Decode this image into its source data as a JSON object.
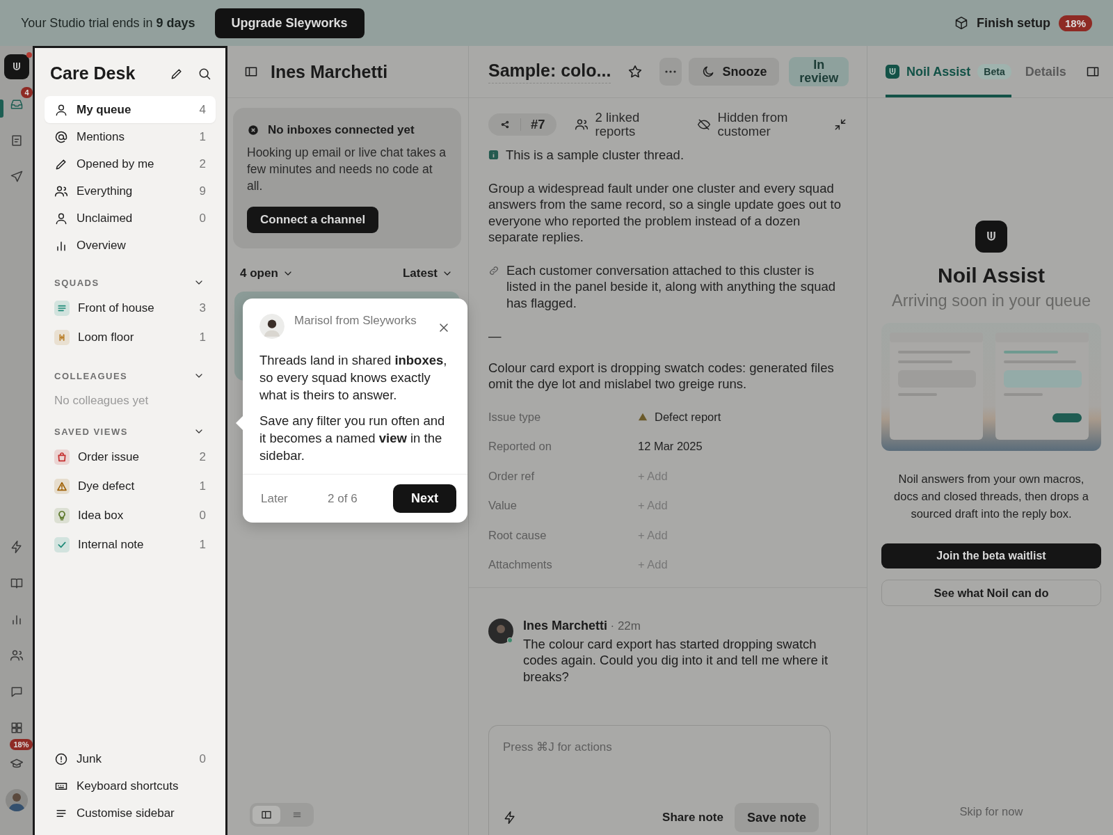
{
  "trial_banner": {
    "text": "Your Studio trial ends in **9 days**",
    "upgrade_button": "Upgrade Sleyworks",
    "setup_label": "Finish setup",
    "setup_percent": "18%"
  },
  "rail": [
    {
      "kind": "logo"
    },
    {
      "kind": "inbox",
      "badge": "4",
      "selected": true
    },
    {
      "kind": "doc",
      "selected": false
    },
    {
      "kind": "send",
      "selected": false
    },
    {
      "kind": "bolt",
      "selected": false
    },
    {
      "kind": "book",
      "selected": false
    },
    {
      "kind": "bars",
      "selected": false
    },
    {
      "kind": "users",
      "selected": false
    },
    {
      "kind": "chat",
      "selected": false
    },
    {
      "kind": "grid",
      "selected": false
    },
    {
      "kind": "cap",
      "badge": "18%",
      "selected": false
    },
    {
      "kind": "avatar"
    }
  ],
  "sidebar": {
    "title": "Care Desk",
    "items": [
      {
        "label": "My queue",
        "count": "4",
        "kind": "user",
        "selected": true
      },
      {
        "label": "Mentions",
        "count": "1",
        "kind": "at",
        "selected": false
      },
      {
        "label": "Opened by me",
        "count": "2",
        "kind": "pencil",
        "selected": false
      },
      {
        "label": "Everything",
        "count": "9",
        "kind": "users",
        "selected": false
      },
      {
        "label": "Unclaimed",
        "count": "0",
        "kind": "user",
        "selected": false
      },
      {
        "label": "Overview",
        "kind": "bars",
        "selected": false
      }
    ],
    "squads": {
      "title": "SQUADS",
      "expanded": true,
      "items": [
        {
          "label": "Front of house",
          "count": "3",
          "kind": "lines",
          "color": "#1e8a78",
          "selected": false
        },
        {
          "label": "Loom floor",
          "count": "1",
          "kind": "loom",
          "color": "#b7791f",
          "selected": false
        }
      ]
    },
    "colleagues": {
      "title": "COLLEAGUES",
      "expanded": true,
      "empty_text": "No colleagues yet"
    },
    "saved_views": {
      "title": "SAVED VIEWS",
      "expanded": true,
      "items": [
        {
          "label": "Order issue",
          "count": "2",
          "kind": "bag",
          "color": "#c53030",
          "selected": false
        },
        {
          "label": "Dye defect",
          "count": "1",
          "kind": "warn",
          "color": "#a16207",
          "selected": false
        },
        {
          "label": "Idea box",
          "count": "0",
          "kind": "bulb",
          "color": "#5f7a2e",
          "selected": false
        },
        {
          "label": "Internal note",
          "count": "1",
          "kind": "check",
          "color": "#1e8a78",
          "selected": false
        }
      ]
    },
    "footer": [
      {
        "label": "Junk",
        "count": "0",
        "kind": "alert"
      },
      {
        "label": "Keyboard shortcuts",
        "kind": "keyboard"
      },
      {
        "label": "Customise sidebar",
        "kind": "lines"
      }
    ]
  },
  "inbox_column": {
    "title": "Ines Marchetti",
    "notice": {
      "title": "No inboxes connected yet",
      "body": "Hooking up email or live chat takes a few minutes and needs no code at all.",
      "button": "Connect a channel"
    },
    "filter": "4 open",
    "sort": "Latest",
    "view_toggle": [
      {
        "kind": "split",
        "selected": true
      },
      {
        "kind": "list",
        "selected": false
      }
    ]
  },
  "tour_popover": {
    "author": "Marisol from Sleyworks",
    "paragraphs": [
      "Threads land in shared **inboxes**, so every squad knows exactly what is theirs to answer.",
      "Save any filter you run often and it becomes a named **view** in the sidebar."
    ],
    "later": "Later",
    "step": "2 of 6",
    "next": "Next"
  },
  "thread": {
    "title": "Sample: colo...",
    "starred": false,
    "snooze": "Snooze",
    "status": "In review",
    "meta": {
      "id": "#7",
      "linked": "2 linked reports",
      "visibility": "Hidden from customer"
    },
    "notice": "This is a sample cluster thread.",
    "paragraphs": [
      "Group a widespread fault under one cluster and every squad answers from the same record, so a single update goes out to everyone who reported the problem instead of a dozen separate replies."
    ],
    "link_note": "Each customer conversation attached to this cluster is listed in the panel beside it, along with anything the squad has flagged.",
    "separator": "—",
    "description": "Colour card export is dropping swatch codes: generated files omit the dye lot and mislabel two greige runs.",
    "fields": [
      {
        "label": "Issue type",
        "value": "Defect report",
        "kind": "warning"
      },
      {
        "label": "Reported on",
        "value": "12 Mar 2025",
        "kind": "value"
      },
      {
        "label": "Order ref",
        "value": "+ Add",
        "kind": "add"
      },
      {
        "label": "Value",
        "value": "+ Add",
        "kind": "add"
      },
      {
        "label": "Root cause",
        "value": "+ Add",
        "kind": "add"
      },
      {
        "label": "Attachments",
        "value": "+ Add",
        "kind": "add"
      }
    ],
    "message": {
      "author": "Ines Marchetti",
      "time": "· 22m",
      "body": "The colour card export has started dropping swatch codes again. Could you dig into it and tell me where it breaks?"
    },
    "composer": {
      "placeholder": "Press ⌘J for actions",
      "share": "Share note",
      "save": "Save note"
    }
  },
  "assist_panel": {
    "tabs": [
      {
        "label": "Noil Assist",
        "badge": "Beta",
        "selected": true
      },
      {
        "label": "Details",
        "selected": false
      }
    ],
    "heading": "Noil Assist",
    "subheading": "Arriving soon in your queue",
    "description": "Noil answers from your own macros, docs and closed threads, then drops a sourced draft into the reply box.",
    "primary_button": "Join the beta waitlist",
    "secondary_button": "See what Noil can do",
    "skip": "Skip for now"
  }
}
